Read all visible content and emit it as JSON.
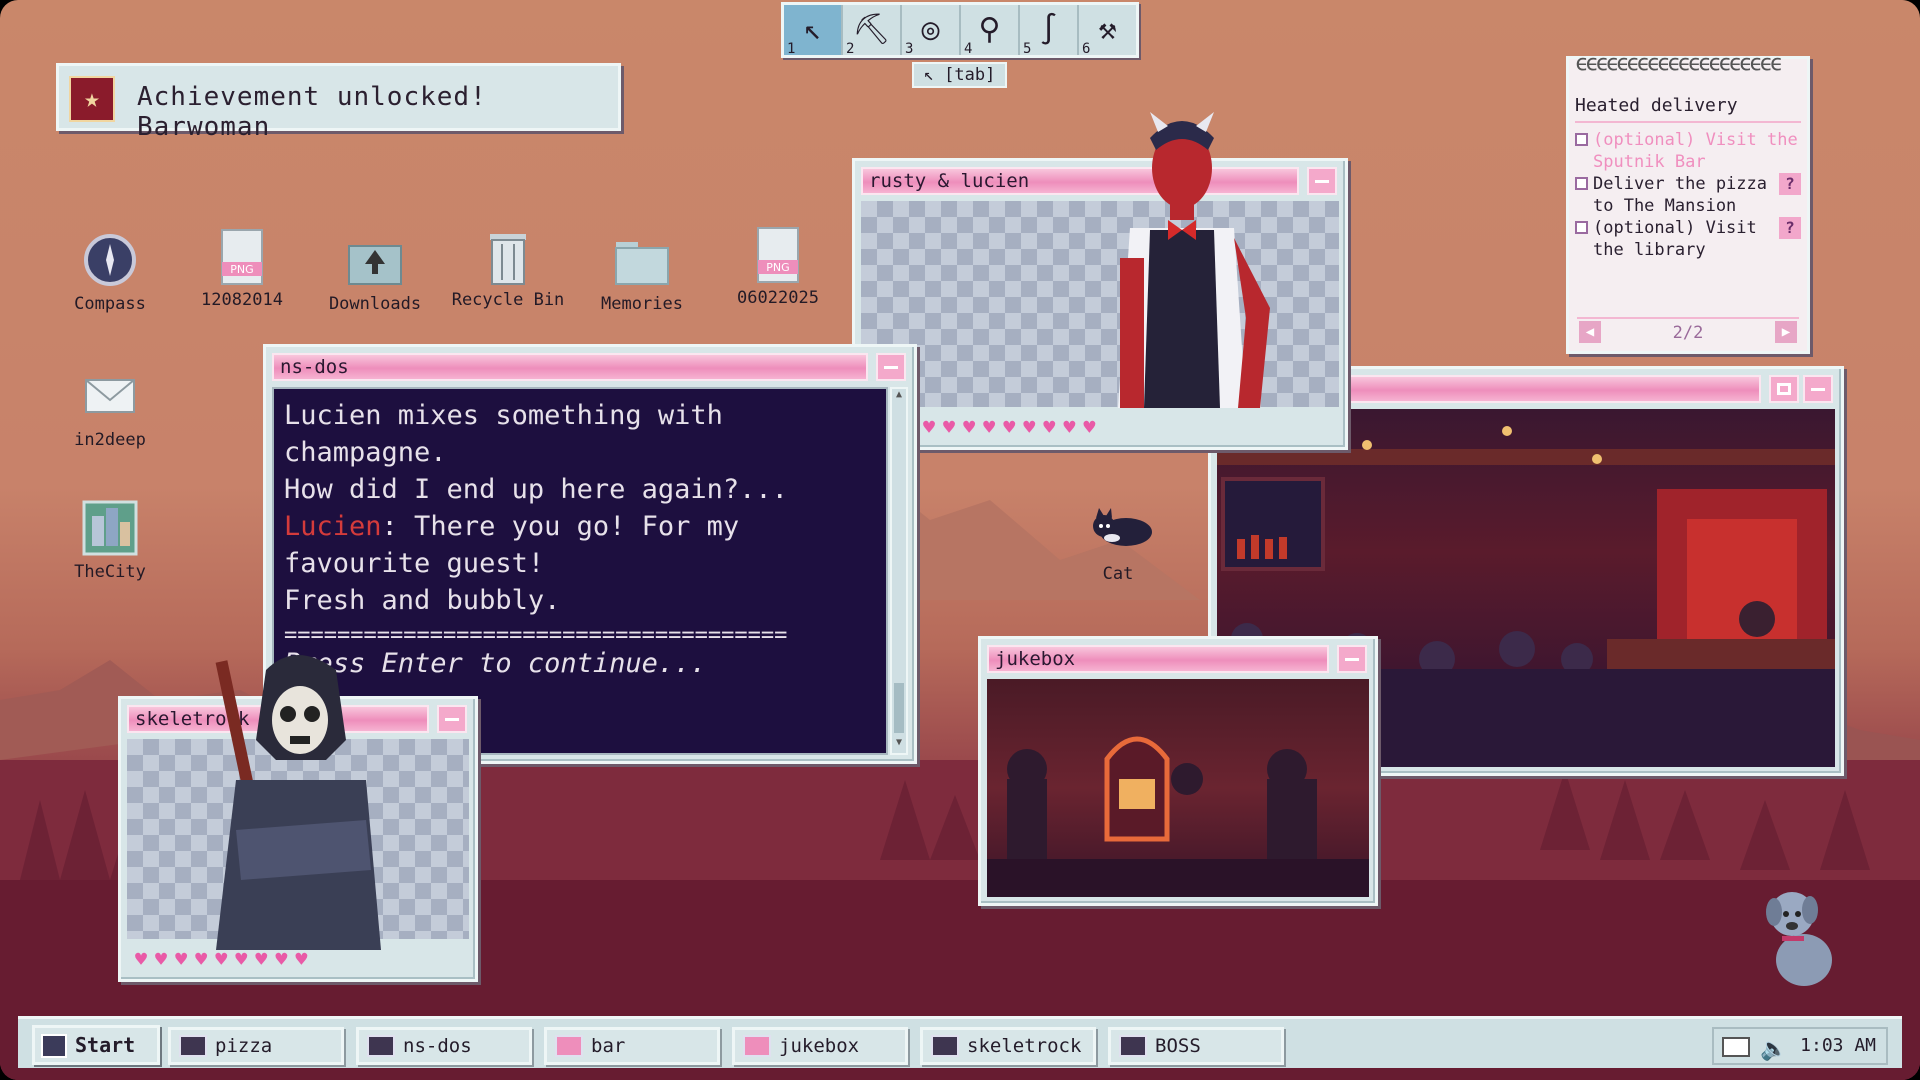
{
  "achievement": {
    "icon": "trophy-icon",
    "text": "Achievement unlocked! Barwoman"
  },
  "toolbar": {
    "tools": [
      {
        "num": "1",
        "icon": "pointer-icon",
        "glyph": "↖"
      },
      {
        "num": "2",
        "icon": "pickaxe-icon",
        "glyph": "⛏"
      },
      {
        "num": "3",
        "icon": "lasso-icon",
        "glyph": "◎"
      },
      {
        "num": "4",
        "icon": "magnifier-icon",
        "glyph": "⚲"
      },
      {
        "num": "5",
        "icon": "hook-icon",
        "glyph": "∫"
      },
      {
        "num": "6",
        "icon": "hammer-icon",
        "glyph": "⚒"
      }
    ],
    "tab_hint": "[tab]"
  },
  "desktop_icons": [
    {
      "label": "Compass",
      "icon": "compass-icon"
    },
    {
      "label": "12082014",
      "icon": "png-file-icon"
    },
    {
      "label": "Downloads",
      "icon": "downloads-folder-icon"
    },
    {
      "label": "Recycle Bin",
      "icon": "recycle-bin-icon"
    },
    {
      "label": "Memories",
      "icon": "folder-icon"
    },
    {
      "label": "06022025",
      "icon": "png-file-icon"
    },
    {
      "label": "in2deep",
      "icon": "mail-icon"
    },
    {
      "label": "TheCity",
      "icon": "city-app-icon"
    },
    {
      "label": "Cat",
      "icon": "cat-icon"
    }
  ],
  "quest": {
    "title": "Heated delivery",
    "tasks": [
      {
        "text": "(optional) Visit the Sputnik Bar",
        "done": true
      },
      {
        "text": "Deliver the pizza to The Mansion",
        "done": false
      },
      {
        "text": "(optional) Visit the library",
        "done": false
      }
    ],
    "help_label": "?",
    "page": "2/2"
  },
  "windows": {
    "rusty": {
      "title": "rusty & lucien"
    },
    "nsdos": {
      "title": "ns-dos",
      "lines": [
        "Lucien mixes something with",
        "champagne.",
        "How did I end up here again?...",
        "",
        "favourite guest!",
        "Fresh and bubbly."
      ],
      "speaker": "Lucien",
      "speaker_line": ": There you go! For my",
      "separator": "======================================",
      "prompt": "Press Enter to continue..."
    },
    "bar": {
      "title": ""
    },
    "jukebox": {
      "title": "jukebox"
    },
    "skeletrock": {
      "title": "skeletrock"
    }
  },
  "hearts_symbol": "♥",
  "taskbar": {
    "start": "Start",
    "buttons": [
      {
        "label": "pizza"
      },
      {
        "label": "ns-dos"
      },
      {
        "label": "bar"
      },
      {
        "label": "jukebox"
      },
      {
        "label": "skeletrock"
      },
      {
        "label": "BOSS"
      }
    ],
    "clock": "1:03 AM"
  }
}
